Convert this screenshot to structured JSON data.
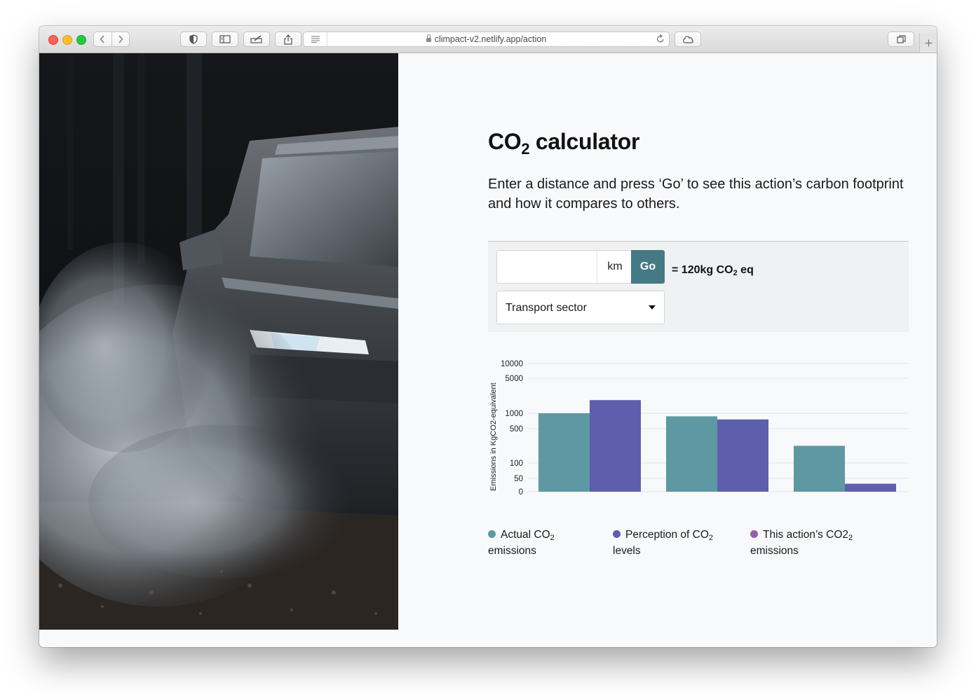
{
  "browser": {
    "url": "climpact-v2.netlify.app/action"
  },
  "page": {
    "title_main": "CO",
    "title_sub": "2",
    "title_rest": " calculator",
    "intro": "Enter a distance and press ‘Go’ to see this action’s carbon footprint and how it compares to others."
  },
  "form": {
    "distance_value": "",
    "distance_unit": "km",
    "go_label": "Go",
    "result_prefix": "= 120kg CO",
    "result_sub": "2",
    "result_suffix": " eq",
    "sector_selected": "Transport sector"
  },
  "colors": {
    "actual": "#5e99a3",
    "perception": "#5d5fac",
    "action": "#9b59b6",
    "go_button": "#457a84"
  },
  "chart_data": {
    "type": "bar",
    "ylabel": "Emissions in KgCO2-equivalent",
    "ytick_labels": [
      "0",
      "50",
      "100",
      "500",
      "1000",
      "5000",
      "10000"
    ],
    "ytick_values": [
      0,
      50,
      100,
      500,
      1000,
      5000,
      10000
    ],
    "scale": "log-like (non-linear) axis",
    "categories": [
      "",
      "",
      ""
    ],
    "series": [
      {
        "name": "Actual CO2 emissions",
        "values": [
          1000,
          900,
          300
        ]
      },
      {
        "name": "Perception of CO2 levels",
        "values": [
          2500,
          800,
          30
        ]
      }
    ],
    "grid": true
  },
  "legend": [
    {
      "label_a": "Actual CO",
      "sub": "2",
      "label_b": "emissions"
    },
    {
      "label_a": "Perception of CO",
      "sub": "2",
      "label_b": "levels"
    },
    {
      "label_a": "This action’s CO2",
      "sub": "2",
      "label_b": "emissions"
    }
  ]
}
